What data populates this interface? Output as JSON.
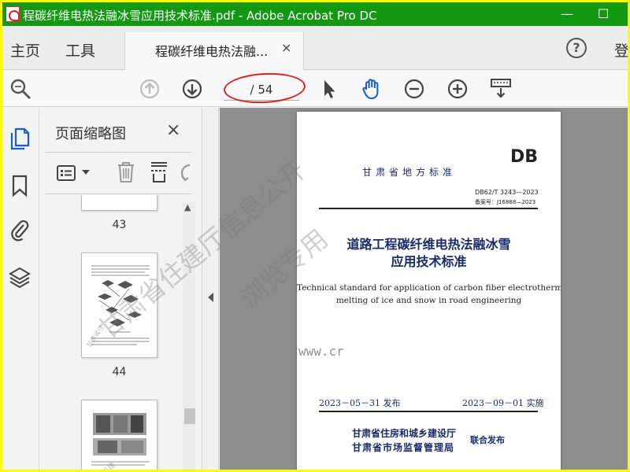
{
  "window": {
    "title": "程碳纤维电热法融冰雪应用技术标准.pdf - Adobe Acrobat Pro DC",
    "min_symbol": "—",
    "max_symbol": "☐",
    "accent": "#149814",
    "highlight_border": "#ffff00"
  },
  "tabs": {
    "home": "主页",
    "tools": "工具",
    "document": "程碳纤维电热法融...",
    "document_close": "×",
    "help": "?",
    "sign_in": "登"
  },
  "toolbar": {
    "page_indicator": "/ 54",
    "annotation_color": "#d22222"
  },
  "sidebar": {
    "rail_icons": [
      "page-thumbnails-icon",
      "bookmark-icon",
      "paperclip-icon",
      "layers-icon"
    ]
  },
  "panel": {
    "title": "页面缩略图",
    "close": "×",
    "thumbnails": [
      {
        "page": "43"
      },
      {
        "page": "44"
      }
    ],
    "scroll_up": "▲"
  },
  "document": {
    "logo": "DB",
    "standard_kind": "甘肃省地方标准",
    "standard_code": "DB62/T 3243—2023",
    "record_code": "备案号：J16888—2023",
    "title_cn_line1": "道路工程碳纤维电热法融冰雪",
    "title_cn_line2": "应用技术标准",
    "title_en_line1": "Technical standard for application of carbon fiber electrothermal",
    "title_en_line2": "melting of ice and snow in road engineering",
    "issue_date": "2023－05－31 发布",
    "implementation_date": "2023－09－01 实施",
    "issuer_line1": "甘肃省住房和城乡建设厅",
    "issuer_line2": "甘肃省市场监督管理局",
    "joint_release": "联合发布"
  },
  "watermark": {
    "line1": "甘肃省住建厅信息公开",
    "line2": "浏览专用",
    "url": "www.cr"
  }
}
